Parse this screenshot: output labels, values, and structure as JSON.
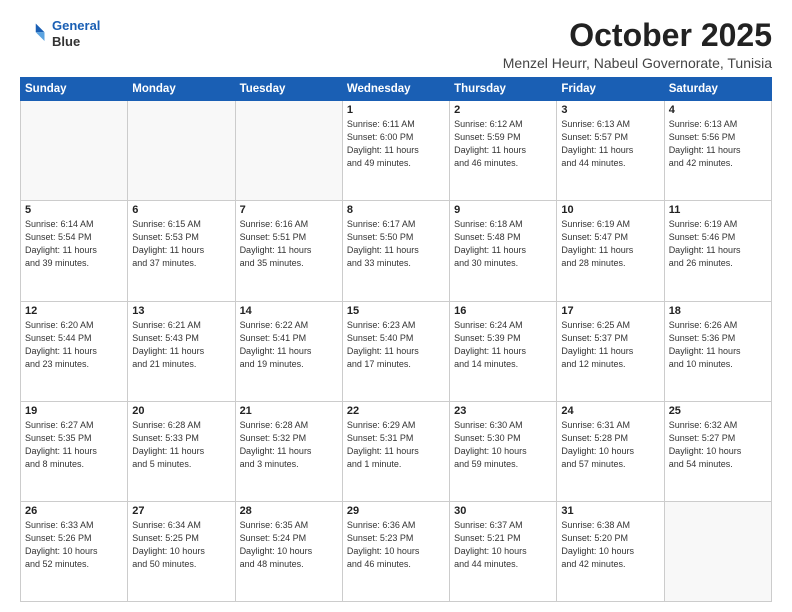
{
  "header": {
    "logo_line1": "General",
    "logo_line2": "Blue",
    "title": "October 2025",
    "subtitle": "Menzel Heurr, Nabeul Governorate, Tunisia"
  },
  "weekdays": [
    "Sunday",
    "Monday",
    "Tuesday",
    "Wednesday",
    "Thursday",
    "Friday",
    "Saturday"
  ],
  "weeks": [
    [
      {
        "day": "",
        "info": ""
      },
      {
        "day": "",
        "info": ""
      },
      {
        "day": "",
        "info": ""
      },
      {
        "day": "1",
        "info": "Sunrise: 6:11 AM\nSunset: 6:00 PM\nDaylight: 11 hours\nand 49 minutes."
      },
      {
        "day": "2",
        "info": "Sunrise: 6:12 AM\nSunset: 5:59 PM\nDaylight: 11 hours\nand 46 minutes."
      },
      {
        "day": "3",
        "info": "Sunrise: 6:13 AM\nSunset: 5:57 PM\nDaylight: 11 hours\nand 44 minutes."
      },
      {
        "day": "4",
        "info": "Sunrise: 6:13 AM\nSunset: 5:56 PM\nDaylight: 11 hours\nand 42 minutes."
      }
    ],
    [
      {
        "day": "5",
        "info": "Sunrise: 6:14 AM\nSunset: 5:54 PM\nDaylight: 11 hours\nand 39 minutes."
      },
      {
        "day": "6",
        "info": "Sunrise: 6:15 AM\nSunset: 5:53 PM\nDaylight: 11 hours\nand 37 minutes."
      },
      {
        "day": "7",
        "info": "Sunrise: 6:16 AM\nSunset: 5:51 PM\nDaylight: 11 hours\nand 35 minutes."
      },
      {
        "day": "8",
        "info": "Sunrise: 6:17 AM\nSunset: 5:50 PM\nDaylight: 11 hours\nand 33 minutes."
      },
      {
        "day": "9",
        "info": "Sunrise: 6:18 AM\nSunset: 5:48 PM\nDaylight: 11 hours\nand 30 minutes."
      },
      {
        "day": "10",
        "info": "Sunrise: 6:19 AM\nSunset: 5:47 PM\nDaylight: 11 hours\nand 28 minutes."
      },
      {
        "day": "11",
        "info": "Sunrise: 6:19 AM\nSunset: 5:46 PM\nDaylight: 11 hours\nand 26 minutes."
      }
    ],
    [
      {
        "day": "12",
        "info": "Sunrise: 6:20 AM\nSunset: 5:44 PM\nDaylight: 11 hours\nand 23 minutes."
      },
      {
        "day": "13",
        "info": "Sunrise: 6:21 AM\nSunset: 5:43 PM\nDaylight: 11 hours\nand 21 minutes."
      },
      {
        "day": "14",
        "info": "Sunrise: 6:22 AM\nSunset: 5:41 PM\nDaylight: 11 hours\nand 19 minutes."
      },
      {
        "day": "15",
        "info": "Sunrise: 6:23 AM\nSunset: 5:40 PM\nDaylight: 11 hours\nand 17 minutes."
      },
      {
        "day": "16",
        "info": "Sunrise: 6:24 AM\nSunset: 5:39 PM\nDaylight: 11 hours\nand 14 minutes."
      },
      {
        "day": "17",
        "info": "Sunrise: 6:25 AM\nSunset: 5:37 PM\nDaylight: 11 hours\nand 12 minutes."
      },
      {
        "day": "18",
        "info": "Sunrise: 6:26 AM\nSunset: 5:36 PM\nDaylight: 11 hours\nand 10 minutes."
      }
    ],
    [
      {
        "day": "19",
        "info": "Sunrise: 6:27 AM\nSunset: 5:35 PM\nDaylight: 11 hours\nand 8 minutes."
      },
      {
        "day": "20",
        "info": "Sunrise: 6:28 AM\nSunset: 5:33 PM\nDaylight: 11 hours\nand 5 minutes."
      },
      {
        "day": "21",
        "info": "Sunrise: 6:28 AM\nSunset: 5:32 PM\nDaylight: 11 hours\nand 3 minutes."
      },
      {
        "day": "22",
        "info": "Sunrise: 6:29 AM\nSunset: 5:31 PM\nDaylight: 11 hours\nand 1 minute."
      },
      {
        "day": "23",
        "info": "Sunrise: 6:30 AM\nSunset: 5:30 PM\nDaylight: 10 hours\nand 59 minutes."
      },
      {
        "day": "24",
        "info": "Sunrise: 6:31 AM\nSunset: 5:28 PM\nDaylight: 10 hours\nand 57 minutes."
      },
      {
        "day": "25",
        "info": "Sunrise: 6:32 AM\nSunset: 5:27 PM\nDaylight: 10 hours\nand 54 minutes."
      }
    ],
    [
      {
        "day": "26",
        "info": "Sunrise: 6:33 AM\nSunset: 5:26 PM\nDaylight: 10 hours\nand 52 minutes."
      },
      {
        "day": "27",
        "info": "Sunrise: 6:34 AM\nSunset: 5:25 PM\nDaylight: 10 hours\nand 50 minutes."
      },
      {
        "day": "28",
        "info": "Sunrise: 6:35 AM\nSunset: 5:24 PM\nDaylight: 10 hours\nand 48 minutes."
      },
      {
        "day": "29",
        "info": "Sunrise: 6:36 AM\nSunset: 5:23 PM\nDaylight: 10 hours\nand 46 minutes."
      },
      {
        "day": "30",
        "info": "Sunrise: 6:37 AM\nSunset: 5:21 PM\nDaylight: 10 hours\nand 44 minutes."
      },
      {
        "day": "31",
        "info": "Sunrise: 6:38 AM\nSunset: 5:20 PM\nDaylight: 10 hours\nand 42 minutes."
      },
      {
        "day": "",
        "info": ""
      }
    ]
  ]
}
